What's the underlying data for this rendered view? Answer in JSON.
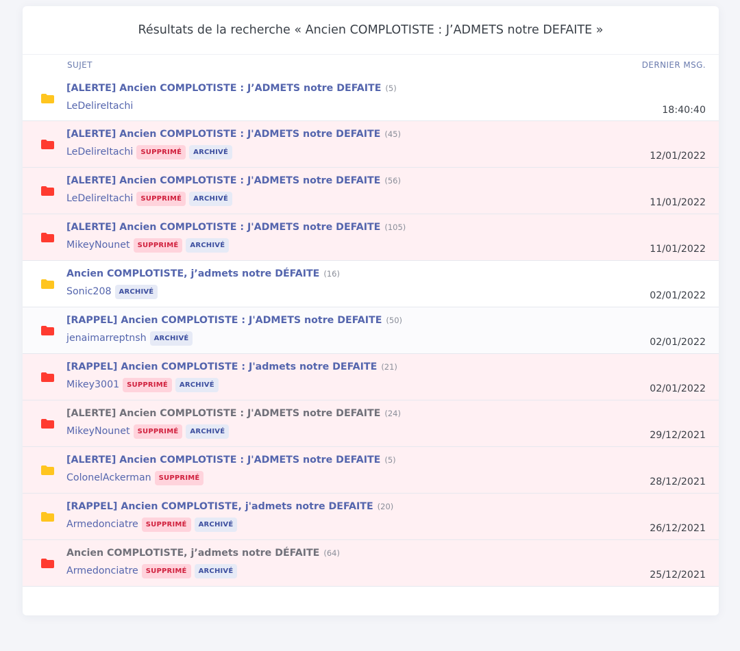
{
  "title": "Résultats de la recherche « Ancien COMPLOTISTE : J’ADMETS notre DEFAITE »",
  "columns": {
    "subject": "SUJET",
    "last_message": "DERNIER MSG."
  },
  "colors": {
    "folder_yellow": "#ffc51f",
    "folder_red": "#ff3b30",
    "link": "#5465ad",
    "row_pink": "#fff0f3"
  },
  "rows": [
    {
      "icon": "folder-yellow-icon",
      "title": "[ALERTE] Ancien COMPLOTISTE : J’ADMETS notre DEFAITE",
      "count": "(5)",
      "author": "LeDelireItachi",
      "badges": [],
      "date": "18:40:40",
      "title_style": "link",
      "bg": "white"
    },
    {
      "icon": "folder-red-icon",
      "title": "[ALERTE] Ancien COMPLOTISTE : J'ADMETS notre DEFAITE",
      "count": "(45)",
      "author": "LeDelireItachi",
      "badges": [
        "SUPPRIMÉ",
        "ARCHIVÉ"
      ],
      "date": "12/01/2022",
      "title_style": "link",
      "bg": "pink"
    },
    {
      "icon": "folder-red-icon",
      "title": "[ALERTE] Ancien COMPLOTISTE : J'ADMETS notre DEFAITE",
      "count": "(56)",
      "author": "LeDelireItachi",
      "badges": [
        "SUPPRIMÉ",
        "ARCHIVÉ"
      ],
      "date": "11/01/2022",
      "title_style": "link",
      "bg": "pink"
    },
    {
      "icon": "folder-red-icon",
      "title": "[ALERTE] Ancien COMPLOTISTE : J'ADMETS notre DEFAITE",
      "count": "(105)",
      "author": "MikeyNounet",
      "badges": [
        "SUPPRIMÉ",
        "ARCHIVÉ"
      ],
      "date": "11/01/2022",
      "title_style": "link",
      "bg": "pink"
    },
    {
      "icon": "folder-yellow-icon",
      "title": "Ancien COMPLOTISTE, j’admets notre DÉFAITE",
      "count": "(16)",
      "author": "Sonic208",
      "badges": [
        "ARCHIVÉ"
      ],
      "date": "02/01/2022",
      "title_style": "link",
      "bg": "white"
    },
    {
      "icon": "folder-red-icon",
      "title": "[RAPPEL] Ancien COMPLOTISTE : J'ADMETS notre DEFAITE",
      "count": "(50)",
      "author": "jenaimarreptnsh",
      "badges": [
        "ARCHIVÉ"
      ],
      "date": "02/01/2022",
      "title_style": "link",
      "bg": "white-alt"
    },
    {
      "icon": "folder-red-icon",
      "title": "[RAPPEL] Ancien COMPLOTISTE : J'admets notre DEFAITE",
      "count": "(21)",
      "author": "Mikey3001",
      "badges": [
        "SUPPRIMÉ",
        "ARCHIVÉ"
      ],
      "date": "02/01/2022",
      "title_style": "link",
      "bg": "pink"
    },
    {
      "icon": "folder-red-icon",
      "title": "[ALERTE] Ancien COMPLOTISTE : J'ADMETS notre DEFAITE",
      "count": "(24)",
      "author": "MikeyNounet",
      "badges": [
        "SUPPRIMÉ",
        "ARCHIVÉ"
      ],
      "date": "29/12/2021",
      "title_style": "gray",
      "bg": "pink"
    },
    {
      "icon": "folder-yellow-icon",
      "title": "[ALERTE] Ancien COMPLOTISTE : J'ADMETS notre DEFAITE",
      "count": "(5)",
      "author": "ColonelAckerman",
      "badges": [
        "SUPPRIMÉ"
      ],
      "date": "28/12/2021",
      "title_style": "link",
      "bg": "pink"
    },
    {
      "icon": "folder-yellow-icon",
      "title": "[RAPPEL] Ancien COMPLOTISTE, j'admets notre DEFAITE",
      "count": "(20)",
      "author": "Armedonciatre",
      "badges": [
        "SUPPRIMÉ",
        "ARCHIVÉ"
      ],
      "date": "26/12/2021",
      "title_style": "link",
      "bg": "pink"
    },
    {
      "icon": "folder-red-icon",
      "title": "Ancien COMPLOTISTE, j’admets notre DÉFAITE",
      "count": "(64)",
      "author": "Armedonciatre",
      "badges": [
        "SUPPRIMÉ",
        "ARCHIVÉ"
      ],
      "date": "25/12/2021",
      "title_style": "gray",
      "bg": "pink"
    }
  ]
}
